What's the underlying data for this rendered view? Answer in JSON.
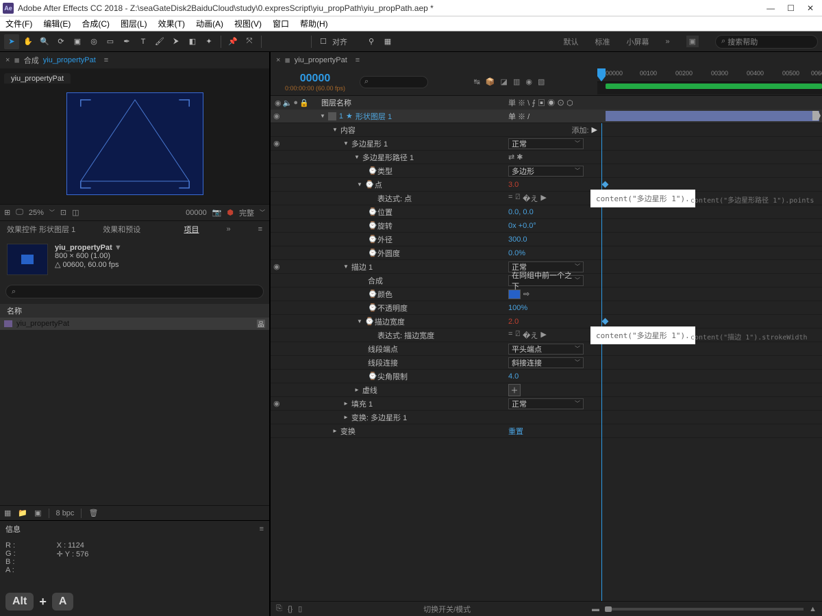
{
  "window": {
    "title": "Adobe After Effects CC 2018 - Z:\\seaGateDisk2BaiduCloud\\study\\0.expresScript\\yiu_propPath\\yiu_propPath.aep *"
  },
  "menus": [
    "文件(F)",
    "编辑(E)",
    "合成(C)",
    "图层(L)",
    "效果(T)",
    "动画(A)",
    "视图(V)",
    "窗口",
    "帮助(H)"
  ],
  "toolbar": {
    "align_label": "对齐",
    "workspaces": [
      "默认",
      "标准",
      "小屏幕"
    ],
    "search_placeholder": "搜索帮助"
  },
  "comp_panel": {
    "prefix": "合成",
    "comp_name": "yiu_propertyPat",
    "tab": "yiu_propertyPat",
    "zoom": "25%",
    "timecode": "00000",
    "res": "完整"
  },
  "effects_row": {
    "effects": "效果控件 形状图层 1",
    "presets": "效果和预设",
    "project": "项目"
  },
  "project": {
    "item_name": "yiu_propertyPat",
    "dims": "800 × 600 (1.00)",
    "dur": "△ 00600, 60.00 fps",
    "col_name": "名称",
    "row": "yiu_propertyPat",
    "bpc": "8 bpc"
  },
  "info": {
    "title": "信息",
    "r": "R :",
    "g": "G :",
    "b": "B :",
    "a": "A :",
    "x": "X : 1124",
    "y": "Y : 576",
    "key1": "Alt",
    "plus": "+",
    "key2": "A"
  },
  "timeline": {
    "tab": "yiu_propertyPat",
    "frame": "00000",
    "tc": "0:00:00:00 (60.00 fps)",
    "ruler": [
      "00000",
      "00100",
      "00200",
      "00300",
      "00400",
      "00500",
      "0060"
    ],
    "col_name": "图层名称",
    "layer": {
      "idx": "1",
      "name": "形状图层 1",
      "sw": "单 ※ /"
    },
    "rows": [
      {
        "ind": 30,
        "tri": "▼",
        "label": "内容",
        "sw_label": "添加:",
        "sw_icon": "▶"
      },
      {
        "ind": 46,
        "tri": "▼",
        "label": "多边星形 1",
        "dd": "正常",
        "eye": "●"
      },
      {
        "ind": 62,
        "tri": "▼",
        "label": "多边星形路径 1",
        "sw_icons": "⇄ ✱"
      },
      {
        "ind": 82,
        "tw": "⌚",
        "label": "类型",
        "dd": "多边形"
      },
      {
        "ind": 66,
        "tri": "▼",
        "tw": "⌚",
        "label": "点",
        "val": "3.0",
        "red": true,
        "kf": true
      },
      {
        "ind": 96,
        "label": "表达式: 点",
        "expr_icons": true,
        "expr_box": "content(\"多边星形 1\").",
        "expr_tail": "content(\"多边星形路径 1\").points"
      },
      {
        "ind": 82,
        "tw": "⌚",
        "label": "位置",
        "val": "0.0, 0.0"
      },
      {
        "ind": 82,
        "tw": "⌚",
        "label": "旋转",
        "val": "0x +0.0°"
      },
      {
        "ind": 82,
        "tw": "⌚",
        "label": "外径",
        "val": "300.0"
      },
      {
        "ind": 82,
        "tw": "⌚",
        "label": "外圆度",
        "val": "0.0%"
      },
      {
        "ind": 46,
        "tri": "▼",
        "label": "描边 1",
        "dd": "正常",
        "eye": "●"
      },
      {
        "ind": 82,
        "label": "合成",
        "dd": "在同组中前一个之下"
      },
      {
        "ind": 82,
        "tw": "⌚",
        "label": "颜色",
        "color": true
      },
      {
        "ind": 82,
        "tw": "⌚",
        "label": "不透明度",
        "val": "100%"
      },
      {
        "ind": 66,
        "tri": "▼",
        "tw": "⌚",
        "label": "描边宽度",
        "val": "2.0",
        "red": true,
        "kf": true
      },
      {
        "ind": 96,
        "label": "表达式: 描边宽度",
        "expr_icons": true,
        "expr_box": "content(\"多边星形 1\").",
        "expr_tail": "content(\"描边 1\").strokeWidth"
      },
      {
        "ind": 82,
        "label": "线段端点",
        "dd": "平头端点"
      },
      {
        "ind": 82,
        "label": "线段连接",
        "dd": "斜接连接"
      },
      {
        "ind": 82,
        "tw": "⌚",
        "label": "尖角限制",
        "val": "4.0"
      },
      {
        "ind": 62,
        "tri": "►",
        "label": "虚线",
        "sw_plus": "＋"
      },
      {
        "ind": 46,
        "tri": "►",
        "label": "填充 1",
        "dd": "正常",
        "eye": "●"
      },
      {
        "ind": 46,
        "tri": "►",
        "label": "变换: 多边星形 1"
      },
      {
        "ind": 30,
        "tri": "►",
        "label": "变换",
        "val": "重置"
      }
    ],
    "footer_label": "切换开关/模式"
  }
}
